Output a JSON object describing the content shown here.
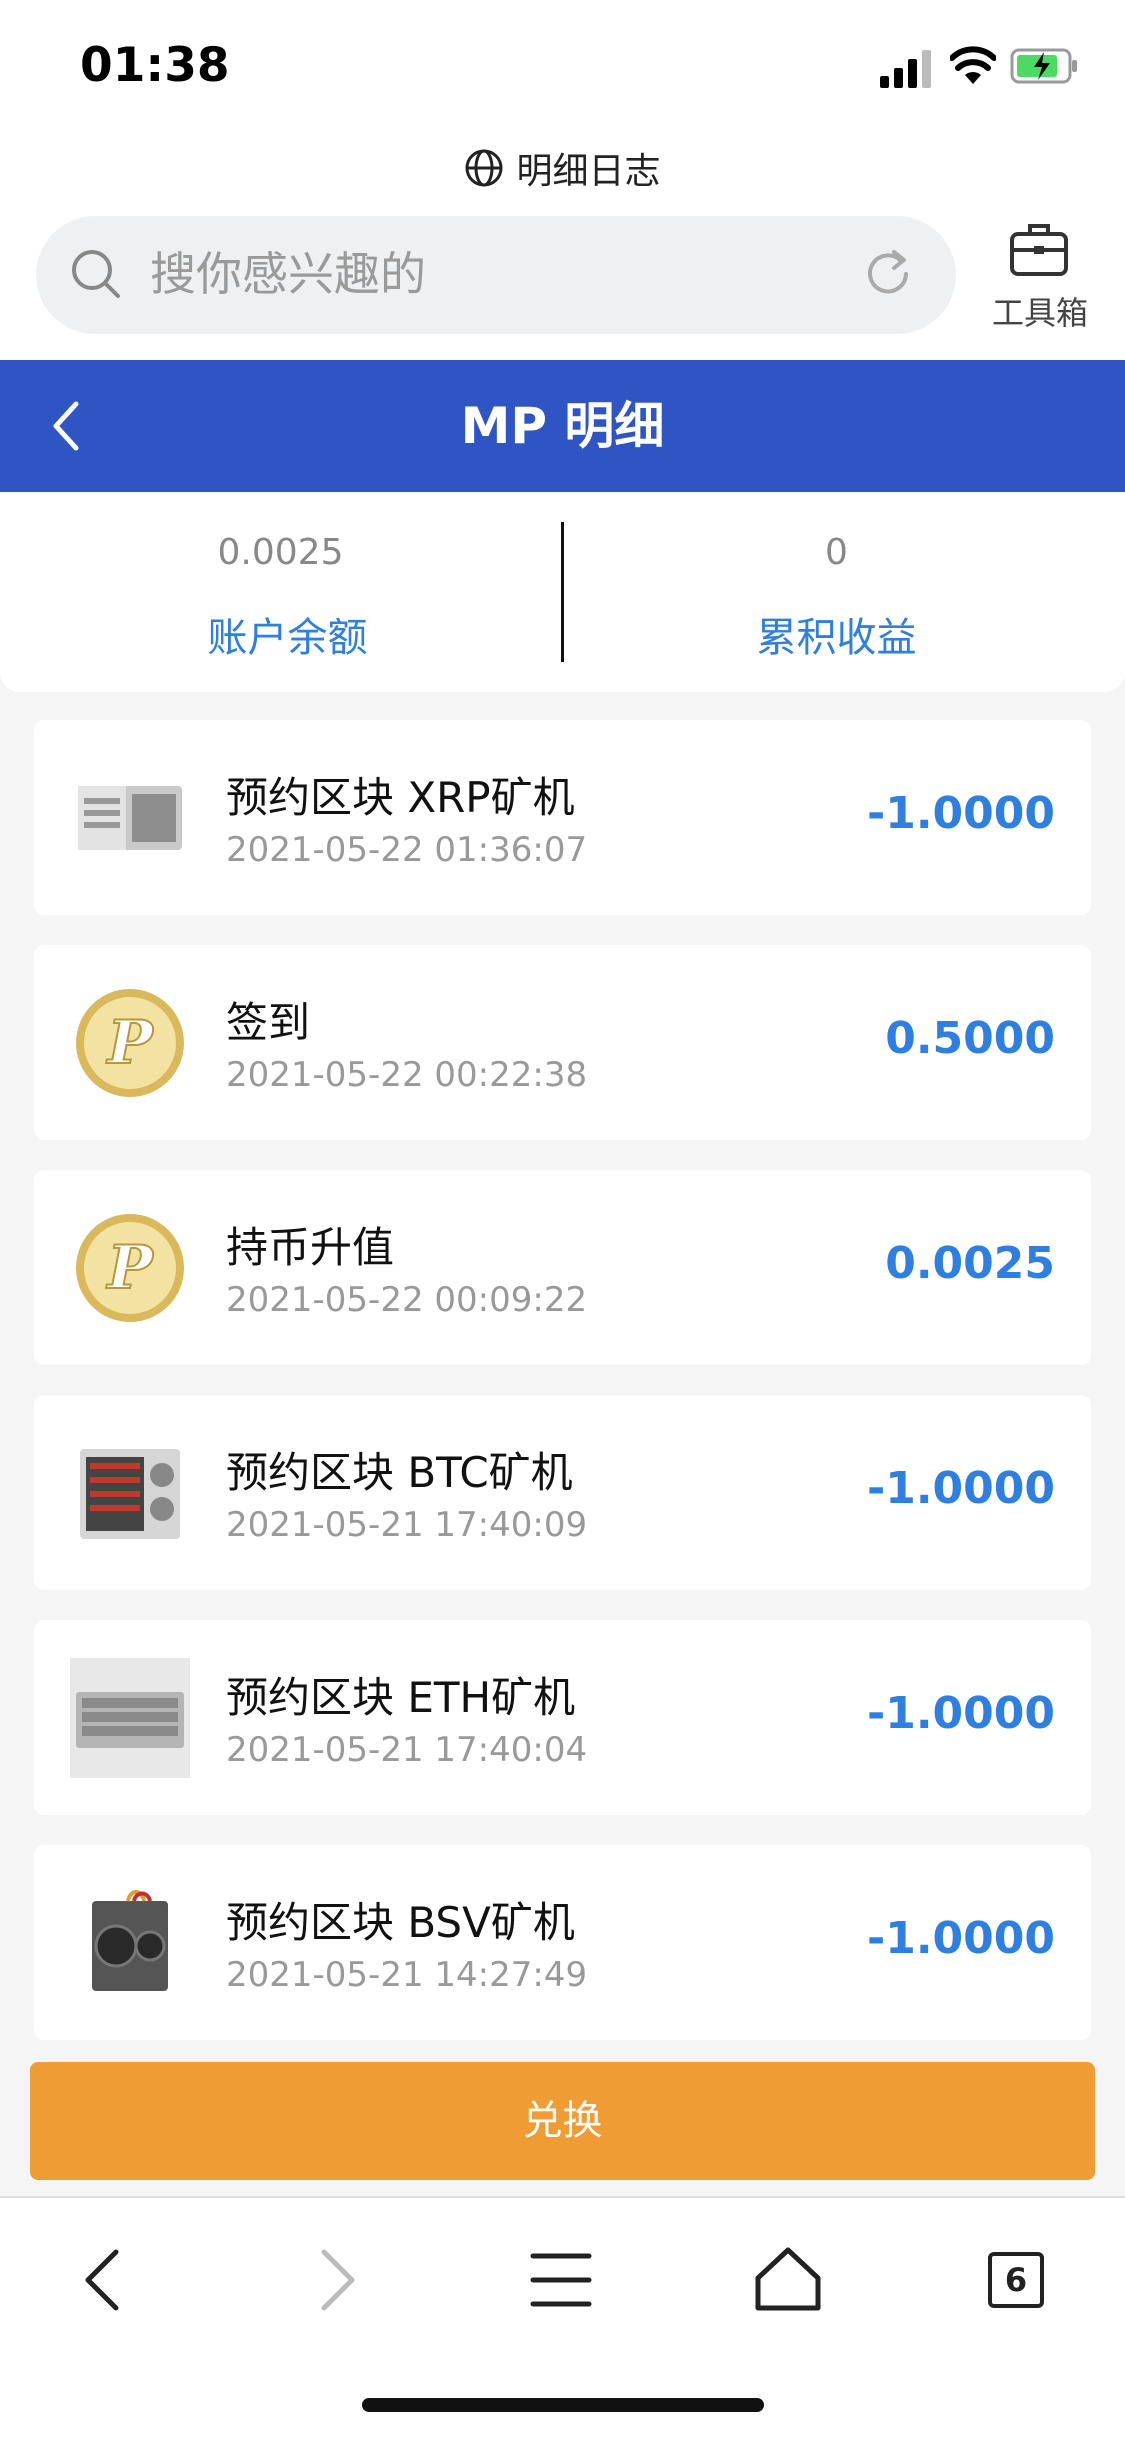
{
  "status": {
    "time": "01:38"
  },
  "browser": {
    "site_title": "明细日志",
    "search_placeholder": "搜你感兴趣的",
    "toolbox_label": "工具箱",
    "tab_count": "6"
  },
  "header": {
    "title": "MP 明细"
  },
  "summary": {
    "balance_value": "0.0025",
    "balance_label": "账户余额",
    "earnings_value": "0",
    "earnings_label": "累积收益"
  },
  "records": [
    {
      "name": "预约区块 XRP矿机",
      "date": "2021-05-22 01:36:07",
      "amount": "-1.0000",
      "icon": "xrp-miner-image"
    },
    {
      "name": "签到",
      "date": "2021-05-22 00:22:38",
      "amount": "0.5000",
      "icon": "p-coin-icon"
    },
    {
      "name": "持币升值",
      "date": "2021-05-22 00:09:22",
      "amount": "0.0025",
      "icon": "p-coin-icon"
    },
    {
      "name": "预约区块 BTC矿机",
      "date": "2021-05-21 17:40:09",
      "amount": "-1.0000",
      "icon": "btc-miner-image"
    },
    {
      "name": "预约区块 ETH矿机",
      "date": "2021-05-21 17:40:04",
      "amount": "-1.0000",
      "icon": "eth-miner-image"
    },
    {
      "name": "预约区块 BSV矿机",
      "date": "2021-05-21 14:27:49",
      "amount": "-1.0000",
      "icon": "bsv-miner-image"
    }
  ],
  "actions": {
    "exchange_label": "兑换"
  },
  "colors": {
    "header": "#2f54c4",
    "accent": "#2f7fe0",
    "exchange": "#f09c35"
  }
}
